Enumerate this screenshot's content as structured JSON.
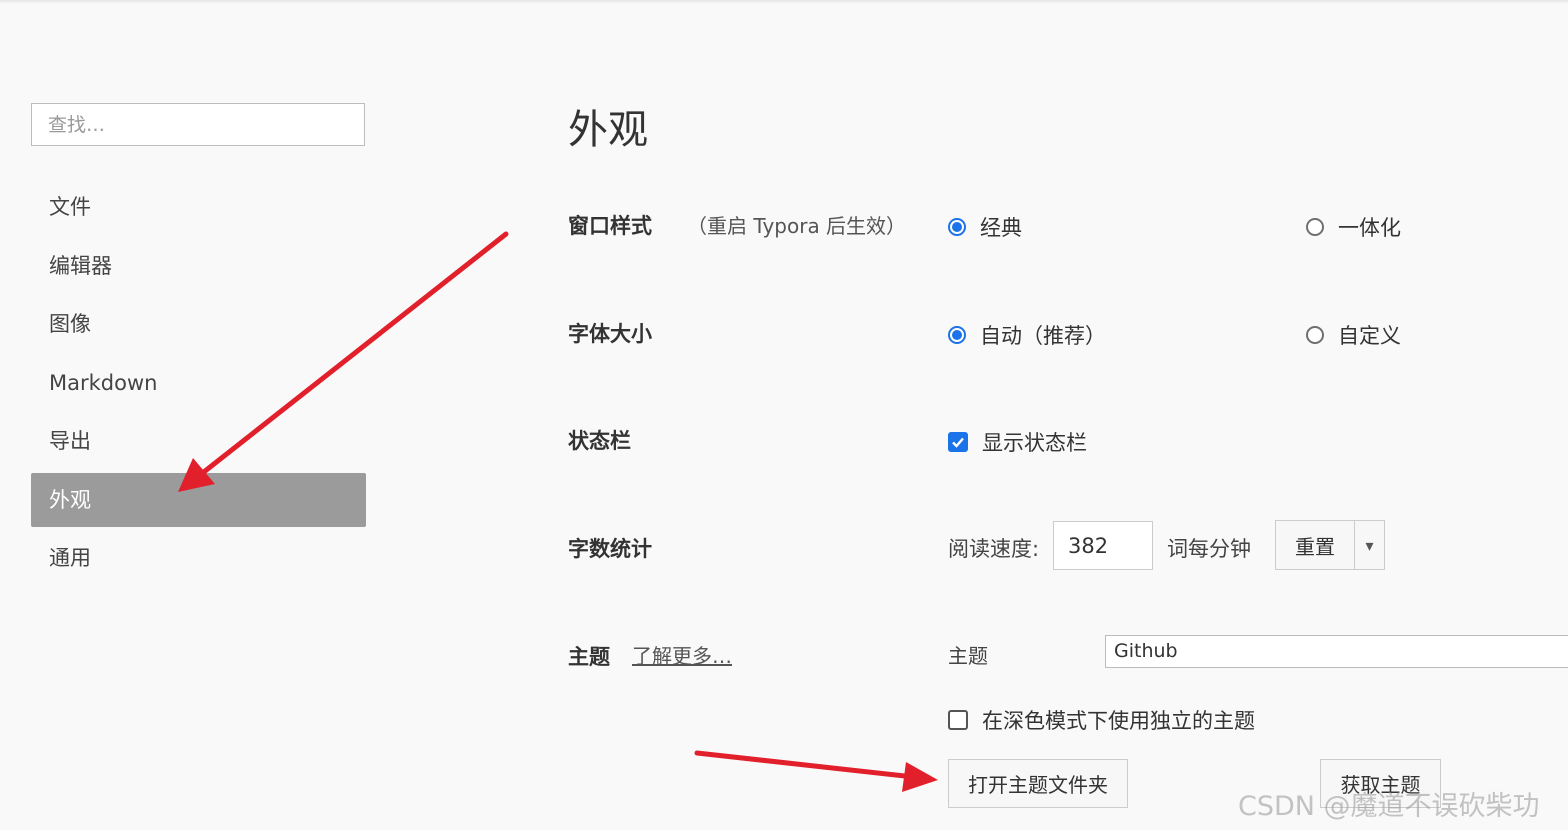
{
  "sidebar": {
    "search_placeholder": "查找…",
    "items": [
      "文件",
      "编辑器",
      "图像",
      "Markdown",
      "导出",
      "外观",
      "通用"
    ],
    "active_index": 5
  },
  "main": {
    "title": "外观",
    "window_style": {
      "label": "窗口样式",
      "hint": "（重启 Typora 后生效）",
      "options": [
        "经典",
        "一体化"
      ],
      "selected": "经典"
    },
    "font_size": {
      "label": "字体大小",
      "options": [
        "自动（推荐）",
        "自定义"
      ],
      "selected": "自动（推荐）"
    },
    "status_bar": {
      "label": "状态栏",
      "checkbox_label": "显示状态栏",
      "checked": true
    },
    "word_count": {
      "label": "字数统计",
      "speed_label": "阅读速度:",
      "speed_value": "382",
      "unit": "词每分钟",
      "reset_label": "重置",
      "dropdown_glyph": "▾"
    },
    "theme": {
      "label": "主题",
      "learn_more": "了解更多…",
      "field_label": "主题",
      "selected": "Github",
      "dark_checkbox_label": "在深色模式下使用独立的主题",
      "dark_checked": false,
      "open_folder_label": "打开主题文件夹",
      "get_themes_label": "获取主题"
    }
  },
  "colors": {
    "accent": "#1a73e8",
    "active_nav": "#9b9b9b",
    "annotation_arrow": "#e2202c"
  },
  "watermark": "CSDN @魔道不误砍柴功"
}
